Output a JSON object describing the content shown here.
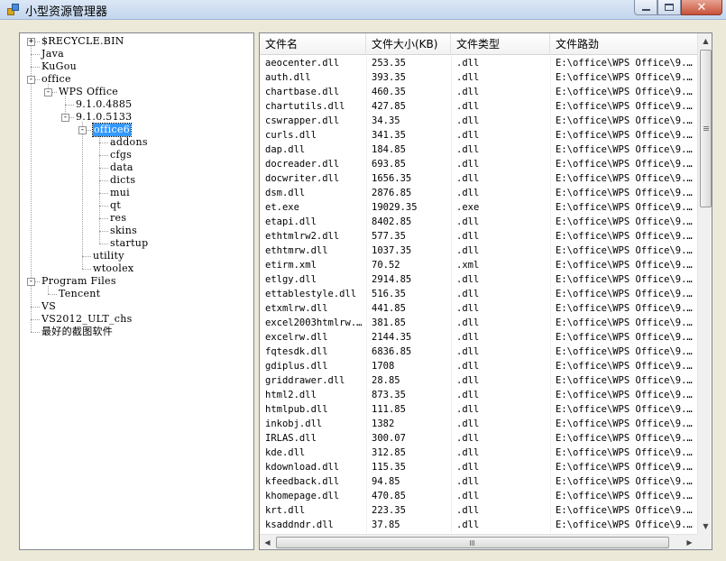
{
  "window": {
    "title": "小型资源管理器"
  },
  "tree": {
    "nodes": [
      {
        "label": "$RECYCLE.BIN",
        "depth": 0,
        "expander": "+"
      },
      {
        "label": "Java",
        "depth": 0
      },
      {
        "label": "KuGou",
        "depth": 0
      },
      {
        "label": "office",
        "depth": 0,
        "expander": "-"
      },
      {
        "label": "WPS Office",
        "depth": 1,
        "expander": "-"
      },
      {
        "label": "9.1.0.4885",
        "depth": 2
      },
      {
        "label": "9.1.0.5133",
        "depth": 2,
        "expander": "-"
      },
      {
        "label": "office6",
        "depth": 3,
        "expander": "-",
        "selected": true
      },
      {
        "label": "addons",
        "depth": 4
      },
      {
        "label": "cfgs",
        "depth": 4
      },
      {
        "label": "data",
        "depth": 4
      },
      {
        "label": "dicts",
        "depth": 4
      },
      {
        "label": "mui",
        "depth": 4
      },
      {
        "label": "qt",
        "depth": 4
      },
      {
        "label": "res",
        "depth": 4
      },
      {
        "label": "skins",
        "depth": 4
      },
      {
        "label": "startup",
        "depth": 4
      },
      {
        "label": "utility",
        "depth": 3
      },
      {
        "label": "wtoolex",
        "depth": 3
      },
      {
        "label": "Program Files",
        "depth": 0,
        "expander": "-"
      },
      {
        "label": "Tencent",
        "depth": 1
      },
      {
        "label": "VS",
        "depth": 0
      },
      {
        "label": "VS2012_ULT_chs",
        "depth": 0
      },
      {
        "label": "最好的截图软件",
        "depth": 0
      }
    ]
  },
  "list": {
    "columns": [
      "文件名",
      "文件大小(KB)",
      "文件类型",
      "文件路劲"
    ],
    "rows": [
      [
        "aeocenter.dll",
        "253.35",
        ".dll",
        "E:\\office\\WPS Office\\9.1..."
      ],
      [
        "auth.dll",
        "393.35",
        ".dll",
        "E:\\office\\WPS Office\\9.1..."
      ],
      [
        "chartbase.dll",
        "460.35",
        ".dll",
        "E:\\office\\WPS Office\\9.1..."
      ],
      [
        "chartutils.dll",
        "427.85",
        ".dll",
        "E:\\office\\WPS Office\\9.1..."
      ],
      [
        "cswrapper.dll",
        "34.35",
        ".dll",
        "E:\\office\\WPS Office\\9.1..."
      ],
      [
        "curls.dll",
        "341.35",
        ".dll",
        "E:\\office\\WPS Office\\9.1..."
      ],
      [
        "dap.dll",
        "184.85",
        ".dll",
        "E:\\office\\WPS Office\\9.1..."
      ],
      [
        "docreader.dll",
        "693.85",
        ".dll",
        "E:\\office\\WPS Office\\9.1..."
      ],
      [
        "docwriter.dll",
        "1656.35",
        ".dll",
        "E:\\office\\WPS Office\\9.1..."
      ],
      [
        "dsm.dll",
        "2876.85",
        ".dll",
        "E:\\office\\WPS Office\\9.1..."
      ],
      [
        "et.exe",
        "19029.35",
        ".exe",
        "E:\\office\\WPS Office\\9.1..."
      ],
      [
        "etapi.dll",
        "8402.85",
        ".dll",
        "E:\\office\\WPS Office\\9.1..."
      ],
      [
        "ethtmlrw2.dll",
        "577.35",
        ".dll",
        "E:\\office\\WPS Office\\9.1..."
      ],
      [
        "ethtmrw.dll",
        "1037.35",
        ".dll",
        "E:\\office\\WPS Office\\9.1..."
      ],
      [
        "etirm.xml",
        "70.52",
        ".xml",
        "E:\\office\\WPS Office\\9.1..."
      ],
      [
        "etlgy.dll",
        "2914.85",
        ".dll",
        "E:\\office\\WPS Office\\9.1..."
      ],
      [
        "ettablestyle.dll",
        "516.35",
        ".dll",
        "E:\\office\\WPS Office\\9.1..."
      ],
      [
        "etxmlrw.dll",
        "441.85",
        ".dll",
        "E:\\office\\WPS Office\\9.1..."
      ],
      [
        "excel2003htmlrw...",
        "381.85",
        ".dll",
        "E:\\office\\WPS Office\\9.1..."
      ],
      [
        "excelrw.dll",
        "2144.35",
        ".dll",
        "E:\\office\\WPS Office\\9.1..."
      ],
      [
        "fqtesdk.dll",
        "6836.85",
        ".dll",
        "E:\\office\\WPS Office\\9.1..."
      ],
      [
        "gdiplus.dll",
        "1708",
        ".dll",
        "E:\\office\\WPS Office\\9.1..."
      ],
      [
        "griddrawer.dll",
        "28.85",
        ".dll",
        "E:\\office\\WPS Office\\9.1..."
      ],
      [
        "html2.dll",
        "873.35",
        ".dll",
        "E:\\office\\WPS Office\\9.1..."
      ],
      [
        "htmlpub.dll",
        "111.85",
        ".dll",
        "E:\\office\\WPS Office\\9.1..."
      ],
      [
        "inkobj.dll",
        "1382",
        ".dll",
        "E:\\office\\WPS Office\\9.1..."
      ],
      [
        "IRLAS.dll",
        "300.07",
        ".dll",
        "E:\\office\\WPS Office\\9.1..."
      ],
      [
        "kde.dll",
        "312.85",
        ".dll",
        "E:\\office\\WPS Office\\9.1..."
      ],
      [
        "kdownload.dll",
        "115.35",
        ".dll",
        "E:\\office\\WPS Office\\9.1..."
      ],
      [
        "kfeedback.dll",
        "94.85",
        ".dll",
        "E:\\office\\WPS Office\\9.1..."
      ],
      [
        "khomepage.dll",
        "470.85",
        ".dll",
        "E:\\office\\WPS Office\\9.1..."
      ],
      [
        "krt.dll",
        "223.35",
        ".dll",
        "E:\\office\\WPS Office\\9.1..."
      ],
      [
        "ksaddndr.dll",
        "37.85",
        ".dll",
        "E:\\office\\WPS Office\\9.1..."
      ]
    ]
  },
  "scrollbars": {
    "up_arrow": "▲",
    "down_arrow": "▼",
    "left_arrow": "◀",
    "right_arrow": "▶"
  }
}
